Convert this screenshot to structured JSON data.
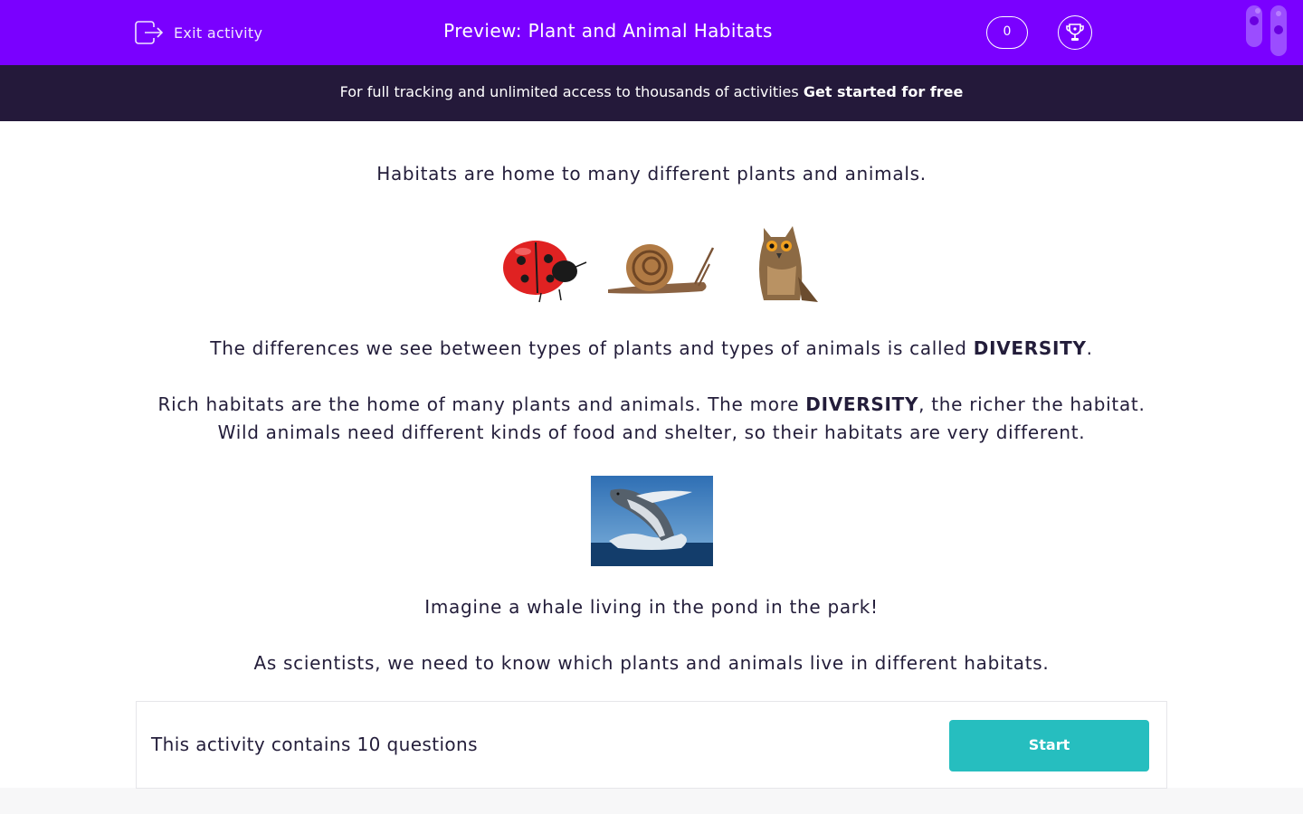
{
  "header": {
    "exit_label": "Exit activity",
    "title": "Preview: Plant and Animal Habitats",
    "score": "0"
  },
  "banner": {
    "text": "For full tracking and unlimited access to thousands of activities",
    "cta": "Get started for free"
  },
  "content": {
    "intro": "Habitats are home to many different plants and animals.",
    "diversity_pre": "The differences we see between types of plants and types of animals is called ",
    "diversity_word": "DIVERSITY",
    "diversity_post": ".",
    "rich_pre": "Rich habitats are the home of many plants and animals. The more ",
    "rich_word": "DIVERSITY",
    "rich_post": ", the richer the habitat. Wild animals need different kinds of food and shelter, so their habitats are very different.",
    "whale_text": "Imagine a whale living in the pond in the park!",
    "scientists_text": "As scientists, we need to know which plants and animals live in different habitats."
  },
  "footer": {
    "count_text": "This activity contains 10 questions",
    "start_label": "Start"
  },
  "colors": {
    "header_bg": "#7a00ff",
    "banner_bg": "#24193a",
    "start_bg": "#26bebf",
    "text": "#231d3a"
  },
  "icons": {
    "exit": "exit-icon",
    "trophy": "trophy-icon",
    "logo": "logo-icon"
  }
}
